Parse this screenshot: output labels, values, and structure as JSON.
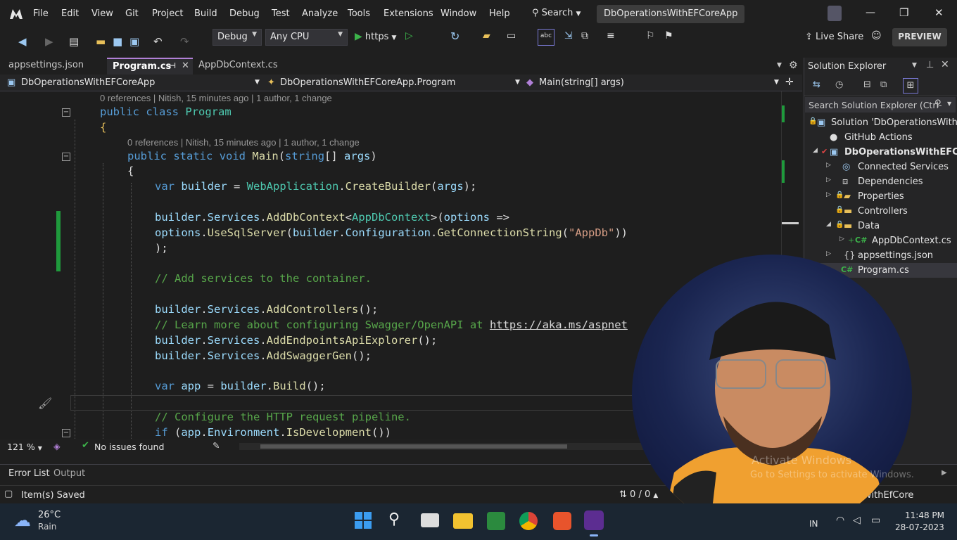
{
  "menu": {
    "items": [
      "File",
      "Edit",
      "View",
      "Git",
      "Project",
      "Build",
      "Debug",
      "Test",
      "Analyze",
      "Tools",
      "Extensions",
      "Window",
      "Help"
    ],
    "search_label": "Search",
    "solution_title": "DbOperationsWithEFCoreApp",
    "minimize": "—",
    "restore": "❐",
    "close": "✕"
  },
  "toolbar": {
    "config": "Debug",
    "platform": "Any CPU",
    "run_target": "https",
    "live_share": "Live Share",
    "preview": "PREVIEW"
  },
  "tabs": [
    {
      "label": "appsettings.json",
      "active": false
    },
    {
      "label": "Program.cs",
      "active": true
    },
    {
      "label": "AppDbContext.cs",
      "active": false
    }
  ],
  "navbar": {
    "project": "DbOperationsWithEFCoreApp",
    "class": "DbOperationsWithEFCoreApp.Program",
    "member": "Main(string[] args)"
  },
  "code": {
    "lens1": "0 references | Nitish, 15 minutes ago | 1 author, 1 change",
    "lens2": "0 references | Nitish, 15 minutes ago | 1 author, 1 change",
    "comment_services": "// Add services to the container.",
    "comment_swagger": "// Learn more about configuring Swagger/OpenAPI at",
    "swagger_link": "https://aka.ms/aspnet",
    "comment_pipeline": "// Configure the HTTP request pipeline.",
    "conn_string": "\"AppDb\""
  },
  "editor_status": {
    "zoom": "121 %",
    "issues": "No issues found"
  },
  "bottom_tabs": [
    "Error List",
    "Output"
  ],
  "statusbar": {
    "saved": "Item(s) Saved",
    "counter": "0 / 0",
    "branch": "WithEfCore"
  },
  "solution_explorer": {
    "title": "Solution Explorer",
    "search_placeholder": "Search Solution Explorer (Ctrl-",
    "items": [
      {
        "label": "Solution 'DbOperationsWithEF",
        "icon": "solution-icon"
      },
      {
        "label": "GitHub Actions",
        "icon": "github-icon"
      },
      {
        "label": "DbOperationsWithEFCore",
        "icon": "project-icon"
      },
      {
        "label": "Connected Services",
        "icon": "connected-services-icon"
      },
      {
        "label": "Dependencies",
        "icon": "dependencies-icon"
      },
      {
        "label": "Properties",
        "icon": "properties-icon"
      },
      {
        "label": "Controllers",
        "icon": "folder-icon"
      },
      {
        "label": "Data",
        "icon": "folder-icon"
      },
      {
        "label": "AppDbContext.cs",
        "icon": "csharp-file-icon"
      },
      {
        "label": "appsettings.json",
        "icon": "json-file-icon"
      },
      {
        "label": "Program.cs",
        "icon": "csharp-file-icon"
      }
    ]
  },
  "watermark": {
    "line1": "Activate Windows",
    "line2": "Go to Settings to activate Windows."
  },
  "taskbar": {
    "temp": "26°C",
    "weather": "Rain",
    "time": "11:48 PM",
    "date": "28-07-2023",
    "lang": "IN"
  },
  "colors": {
    "accent": "#b180d7",
    "keyword": "#569cd6",
    "type": "#4ec9b0",
    "method": "#dcdcaa",
    "comment": "#57a64a",
    "string": "#d69d85",
    "change_bar": "#1f9a3c"
  }
}
